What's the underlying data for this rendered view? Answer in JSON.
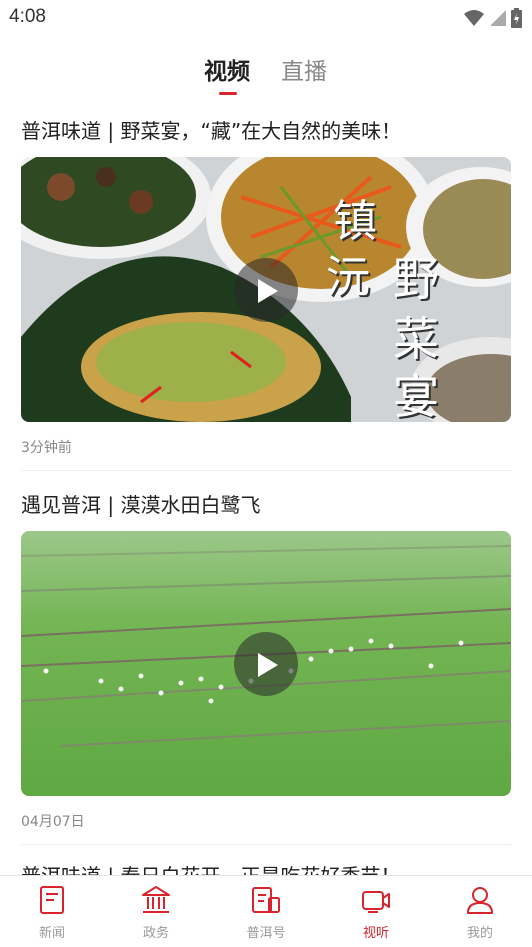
{
  "status": {
    "time": "4:08"
  },
  "tabs": [
    {
      "label": "视频",
      "active": true
    },
    {
      "label": "直播",
      "active": false
    }
  ],
  "feed": [
    {
      "title": "普洱味道 | 野菜宴，“藏”在大自然的美味！",
      "time": "3分钟前",
      "thumb_overlay": [
        "镇",
        "沅",
        "野",
        "菜",
        "宴"
      ]
    },
    {
      "title": "遇见普洱 | 漠漠水田白鹭飞",
      "time": "04月07日"
    },
    {
      "title": "普洱味道 | 春日白花开，正是吃花好季节！"
    }
  ],
  "nav": [
    {
      "label": "新闻",
      "icon": "news-icon",
      "active": false
    },
    {
      "label": "政务",
      "icon": "government-icon",
      "active": false
    },
    {
      "label": "普洱号",
      "icon": "puer-account-icon",
      "active": false
    },
    {
      "label": "视听",
      "icon": "video-audio-icon",
      "active": true
    },
    {
      "label": "我的",
      "icon": "profile-icon",
      "active": false
    }
  ],
  "colors": {
    "accent": "#d9232d",
    "inactive": "#999999"
  }
}
